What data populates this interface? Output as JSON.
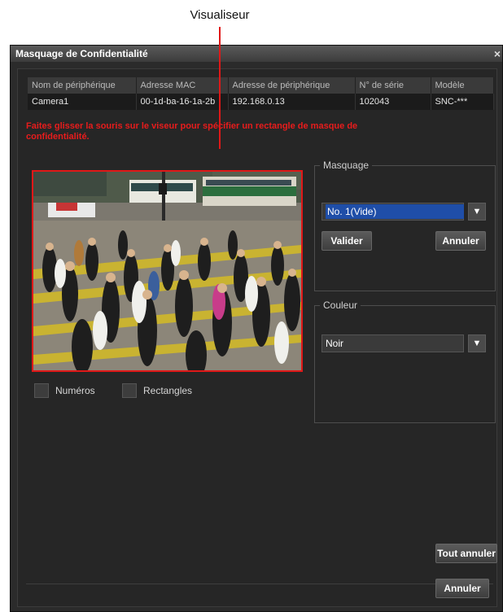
{
  "callout": {
    "label": "Visualiseur"
  },
  "dialog": {
    "title": "Masquage de Confidentialité",
    "close_glyph": "×"
  },
  "device_table": {
    "headers": [
      "Nom de périphérique",
      "Adresse MAC",
      "Adresse de périphérique",
      "N° de série",
      "Modèle"
    ],
    "row": [
      "Camera1",
      "00-1d-ba-16-1a-2b",
      "192.168.0.13",
      "102043",
      "SNC-***"
    ]
  },
  "instruction": "Faites glisser la souris sur le viseur pour spécifier un rectangle de masque de confidentialité.",
  "checkboxes": {
    "numbers": "Numéros",
    "rectangles": "Rectangles"
  },
  "masking": {
    "legend": "Masquage",
    "selected": "No. 1(Vide)",
    "apply": "Valider",
    "cancel": "Annuler"
  },
  "color": {
    "legend": "Couleur",
    "selected": "Noir"
  },
  "buttons": {
    "cancel_all": "Tout annuler",
    "cancel": "Annuler"
  },
  "icons": {
    "dropdown": "▼"
  },
  "colors": {
    "highlight": "#e01818",
    "selection": "#1f4ea8",
    "background": "#2b2b2b"
  }
}
